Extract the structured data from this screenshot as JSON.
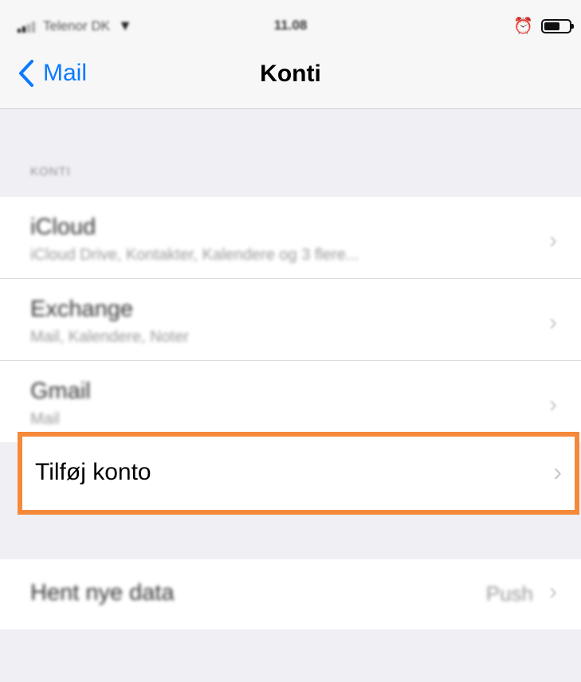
{
  "status": {
    "carrier": "Telenor DK",
    "time": "11.08",
    "wifi_icon": "wifi-icon",
    "alarm_icon": "alarm-icon",
    "battery_icon": "battery-icon",
    "battery_level": 0.55
  },
  "nav": {
    "back_label": "Mail",
    "title": "Konti"
  },
  "accounts_section": {
    "header": "KONTI",
    "items": [
      {
        "title": "iCloud",
        "subtitle": "iCloud Drive, Kontakter, Kalendere og 3 flere..."
      },
      {
        "title": "Exchange",
        "subtitle": "Mail, Kalendere, Noter"
      },
      {
        "title": "Gmail",
        "subtitle": "Mail"
      }
    ],
    "add_account": "Tilføj konto"
  },
  "fetch": {
    "label": "Hent nye data",
    "value": "Push"
  },
  "colors": {
    "accent": "#0a7aff",
    "highlight": "#f5893a",
    "background": "#efeff4"
  }
}
